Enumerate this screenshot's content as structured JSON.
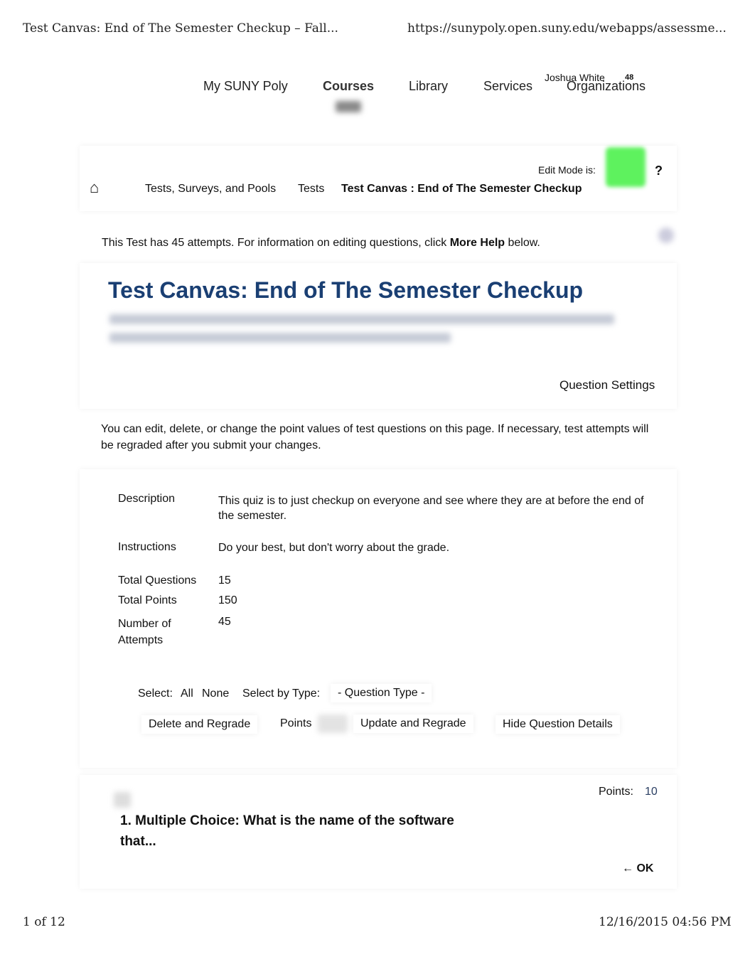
{
  "print_header": {
    "title": "Test Canvas: End of The Semester Checkup – Fall...",
    "url": "https://sunypoly.open.suny.edu/webapps/assessme..."
  },
  "top_nav": {
    "items": [
      "My SUNY Poly",
      "Courses",
      "Library",
      "Services",
      "Organizations"
    ],
    "user": "Joshua White",
    "notifications": "48"
  },
  "breadcrumb": {
    "items": [
      "Tests, Surveys, and Pools",
      "Tests",
      "Test Canvas : End of The Semester Checkup"
    ],
    "edit_mode_label": "Edit Mode is:",
    "help": "?",
    "edit_mode_color": "#5ef25e"
  },
  "info": {
    "prefix": "This Test has 45 attempts. For information on editing questions, click ",
    "link": "More Help",
    "suffix": " below."
  },
  "page_title": "Test Canvas: End of The Semester Checkup",
  "question_settings": "Question Settings",
  "intro": "You can edit, delete, or change the point values of test questions on this page. If necessary, test attempts will be regraded after you submit your changes.",
  "details": [
    {
      "label": "Description",
      "value": "This quiz is to just checkup on everyone and see where they are at before the end of the semester."
    },
    {
      "label": "Instructions",
      "value": "Do your best, but don't worry about the grade."
    },
    {
      "label": "Total Questions",
      "value": "15"
    },
    {
      "label": "Total Points",
      "value": "150"
    },
    {
      "label": "Number of Attempts",
      "value": "45"
    }
  ],
  "select": {
    "label": "Select:",
    "all": "All",
    "none": "None",
    "by_type": "Select by Type:",
    "type_value": "- Question Type -"
  },
  "actions": {
    "delete": "Delete and Regrade",
    "points": "Points",
    "update": "Update and Regrade",
    "hide": "Hide Question Details"
  },
  "question": {
    "points_label": "Points:",
    "points": "10",
    "title": "1. Multiple Choice: What is the name of the software that...",
    "ok": "← OK"
  },
  "print_footer": {
    "page": "1 of 12",
    "datetime": "12/16/2015 04:56 PM"
  }
}
